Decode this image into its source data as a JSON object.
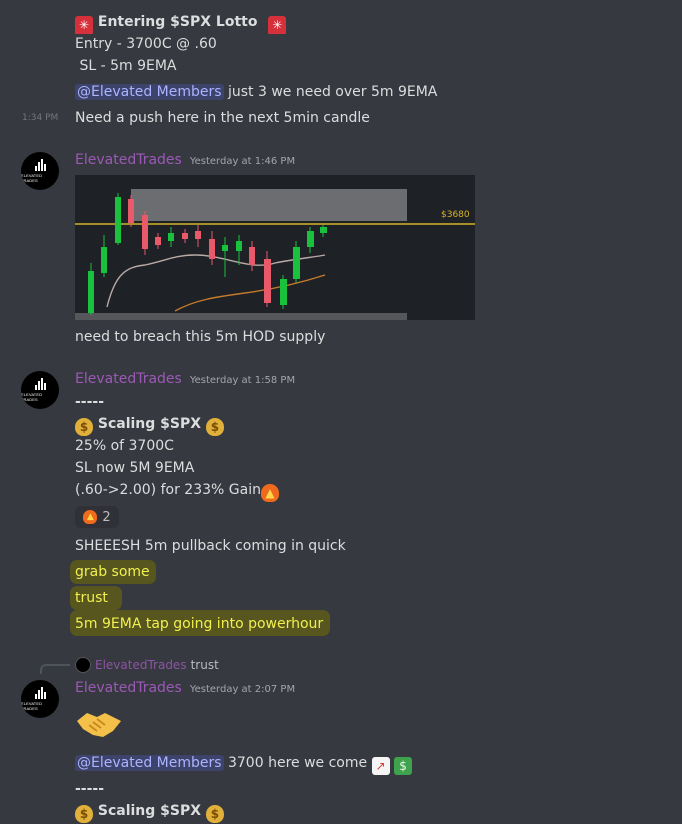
{
  "messages": {
    "m1": {
      "title": "Entering $SPX Lotto",
      "lines": [
        "Entry - 3700C @ .60",
        " SL - 5m 9EMA"
      ],
      "mention": "@Elevated Members",
      "mention_text": " just 3 we need over 5m 9EMA",
      "timestamp": "1:34 PM",
      "followup": "Need a push here in the next 5min candle"
    },
    "m2": {
      "author": "ElevatedTrades",
      "timestamp": "Yesterday at 1:46 PM",
      "caption": "need to breach this 5m HOD supply"
    },
    "m3": {
      "author": "ElevatedTrades",
      "timestamp": "Yesterday at 1:58 PM",
      "divider": "-----",
      "title": "Scaling $SPX",
      "lines": [
        "25% of 3700C",
        "SL now 5M 9EMA",
        "(.60->2.00) for 233% Gain"
      ],
      "reaction_count": "2",
      "after": "SHEEESH 5m pullback coming in quick",
      "highlighted": [
        "grab some",
        "trust",
        "5m 9EMA tap going into powerhour"
      ]
    },
    "m4": {
      "reply_author": "ElevatedTrades",
      "reply_text": "trust",
      "author": "ElevatedTrades",
      "timestamp": "Yesterday at 2:07 PM",
      "mention": "@Elevated Members",
      "mention_text": " 3700 here we come",
      "divider": "-----",
      "title": "Scaling $SPX"
    }
  },
  "avatar_brand": "ELEVATED TRADES",
  "chart_price_label": "$3680",
  "icons": {
    "siren": "police-light-emoji",
    "moneybag": "money-bag-emoji",
    "fire": "fire-emoji",
    "handshake": "handshake-emoji",
    "chart": "chart-increasing-emoji",
    "money": "money-with-wings-emoji"
  },
  "colors": {
    "background": "#36393f",
    "author": "#9b59b6",
    "mention_bg": "#414675",
    "highlight_bg": "#56561e",
    "highlight_text": "#f2f04f",
    "candle_up": "#19c13c",
    "candle_down": "#e8596a",
    "price_line": "#d4b42a"
  }
}
